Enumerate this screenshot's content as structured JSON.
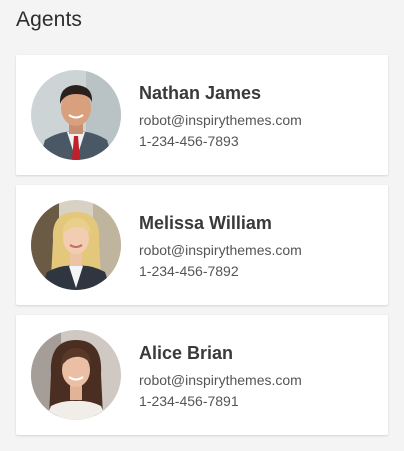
{
  "section": {
    "title": "Agents"
  },
  "agents": [
    {
      "name": "Nathan James",
      "email": "robot@inspirythemes.com",
      "phone": "1-234-456-7893",
      "photo_icon": "man-in-suit-portrait"
    },
    {
      "name": "Melissa William",
      "email": "robot@inspirythemes.com",
      "phone": "1-234-456-7892",
      "photo_icon": "blonde-woman-portrait"
    },
    {
      "name": "Alice Brian",
      "email": "robot@inspirythemes.com",
      "phone": "1-234-456-7891",
      "photo_icon": "brunette-woman-portrait"
    }
  ],
  "colors": {
    "page_background": "#f4f4f4",
    "card_background": "#ffffff",
    "name_text": "#3a3a3a",
    "detail_text": "#555555"
  }
}
